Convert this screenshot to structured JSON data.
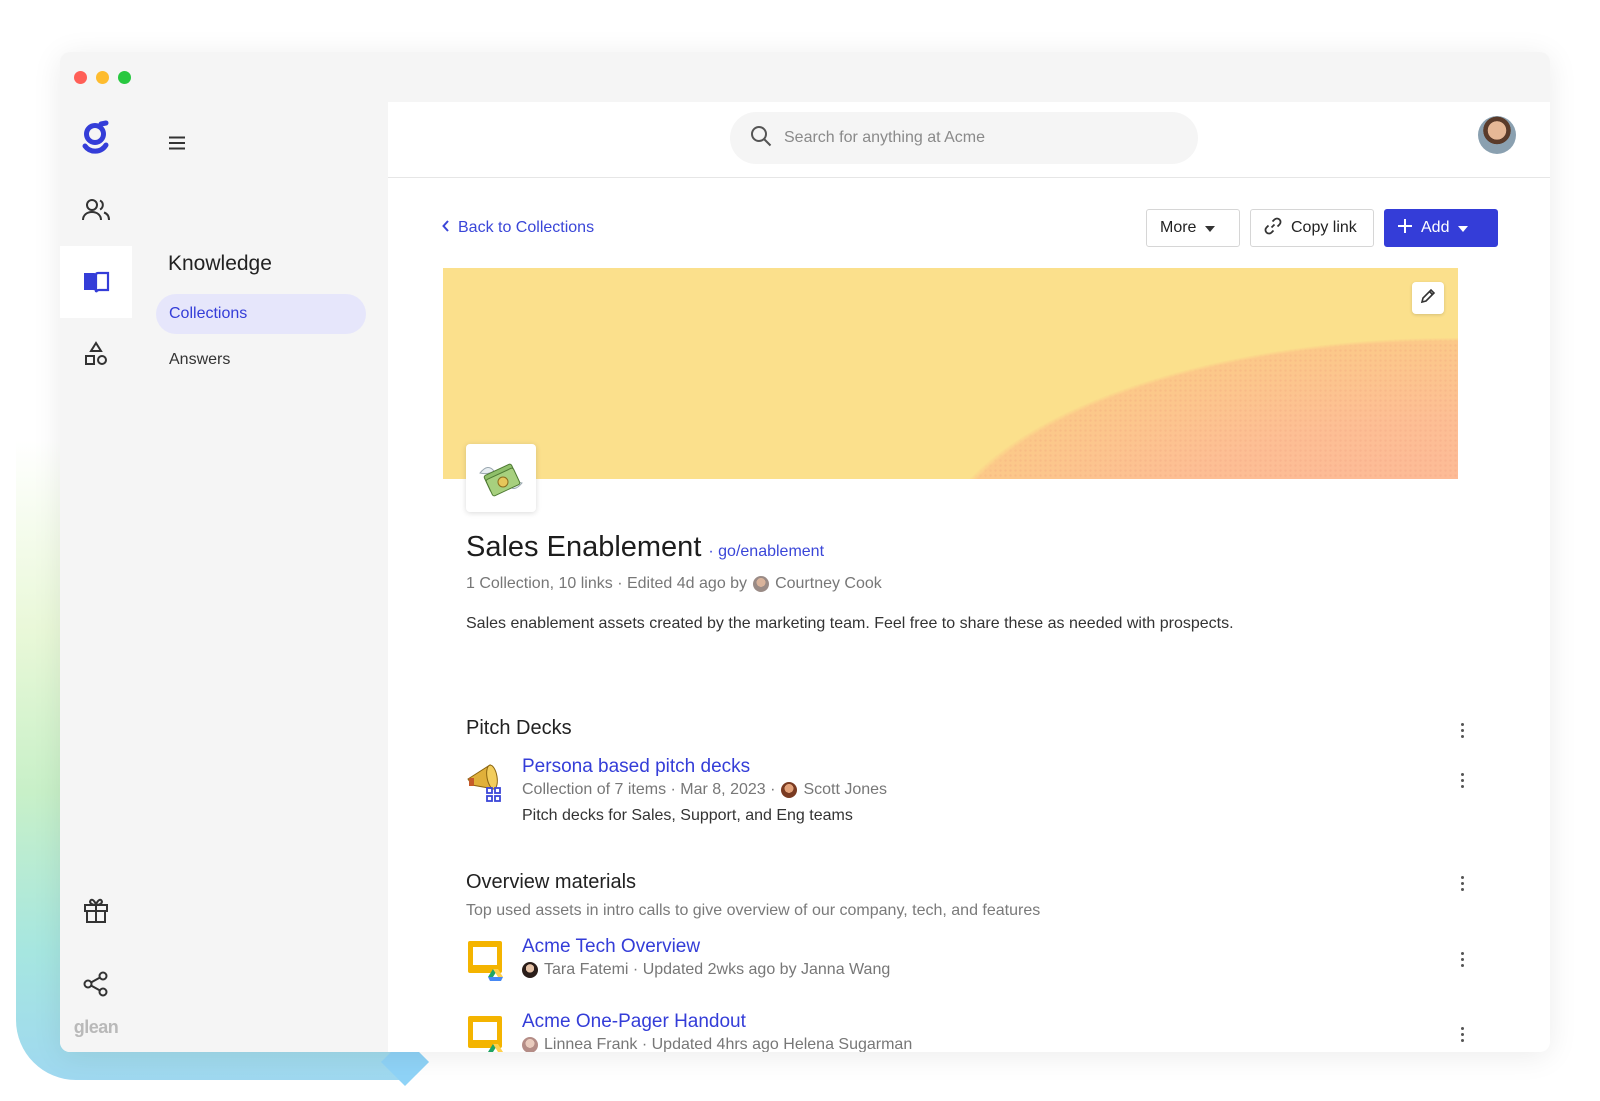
{
  "search": {
    "placeholder": "Search for anything at Acme"
  },
  "rail": {
    "brand_text": "glean"
  },
  "subnav": {
    "title": "Knowledge",
    "items": [
      {
        "label": "Collections",
        "active": true
      },
      {
        "label": "Answers",
        "active": false
      }
    ]
  },
  "toolbar": {
    "back_label": "Back to Collections",
    "more_label": "More",
    "copy_link_label": "Copy link",
    "add_label": "Add"
  },
  "collection": {
    "title": "Sales Enablement",
    "golink": "· go/enablement",
    "meta_prefix": "1 Collection, 10 links · Edited 4d ago by",
    "meta_author": "Courtney Cook",
    "description": "Sales enablement assets created by the marketing team. Feel free to share these as needed with prospects."
  },
  "sections": [
    {
      "title": "Pitch Decks",
      "subtitle": "",
      "items": [
        {
          "title": "Persona based pitch decks",
          "meta_prefix": "Collection of 7 items · Mar 8, 2023 ·",
          "meta_person": "Scott Jones",
          "description": "Pitch decks for Sales, Support, and Eng teams"
        }
      ]
    },
    {
      "title": "Overview materials",
      "subtitle": "Top used assets in intro calls to give overview of our company, tech, and features",
      "items": [
        {
          "title": "Acme Tech Overview",
          "meta": "Tara Fatemi · Updated 2wks ago by Janna Wang"
        },
        {
          "title": "Acme One-Pager Handout",
          "meta": "Linnea Frank · Updated 4hrs ago Helena Sugarman"
        }
      ]
    }
  ],
  "colors": {
    "accent": "#343dd8",
    "active_nav_bg": "#e6e6fb",
    "banner_yellow": "#fbe08c",
    "banner_peach": "#fdb59a"
  },
  "icons": [
    "glean-logo-icon",
    "people-icon",
    "book-icon",
    "shapes-icon",
    "gift-icon",
    "share-icon",
    "hamburger-icon",
    "search-icon",
    "chevron-left-icon",
    "caret-down-icon",
    "link-icon",
    "plus-icon",
    "pencil-icon",
    "money-emoji-icon",
    "megaphone-emoji-icon",
    "google-slides-icon",
    "kebab-icon"
  ]
}
